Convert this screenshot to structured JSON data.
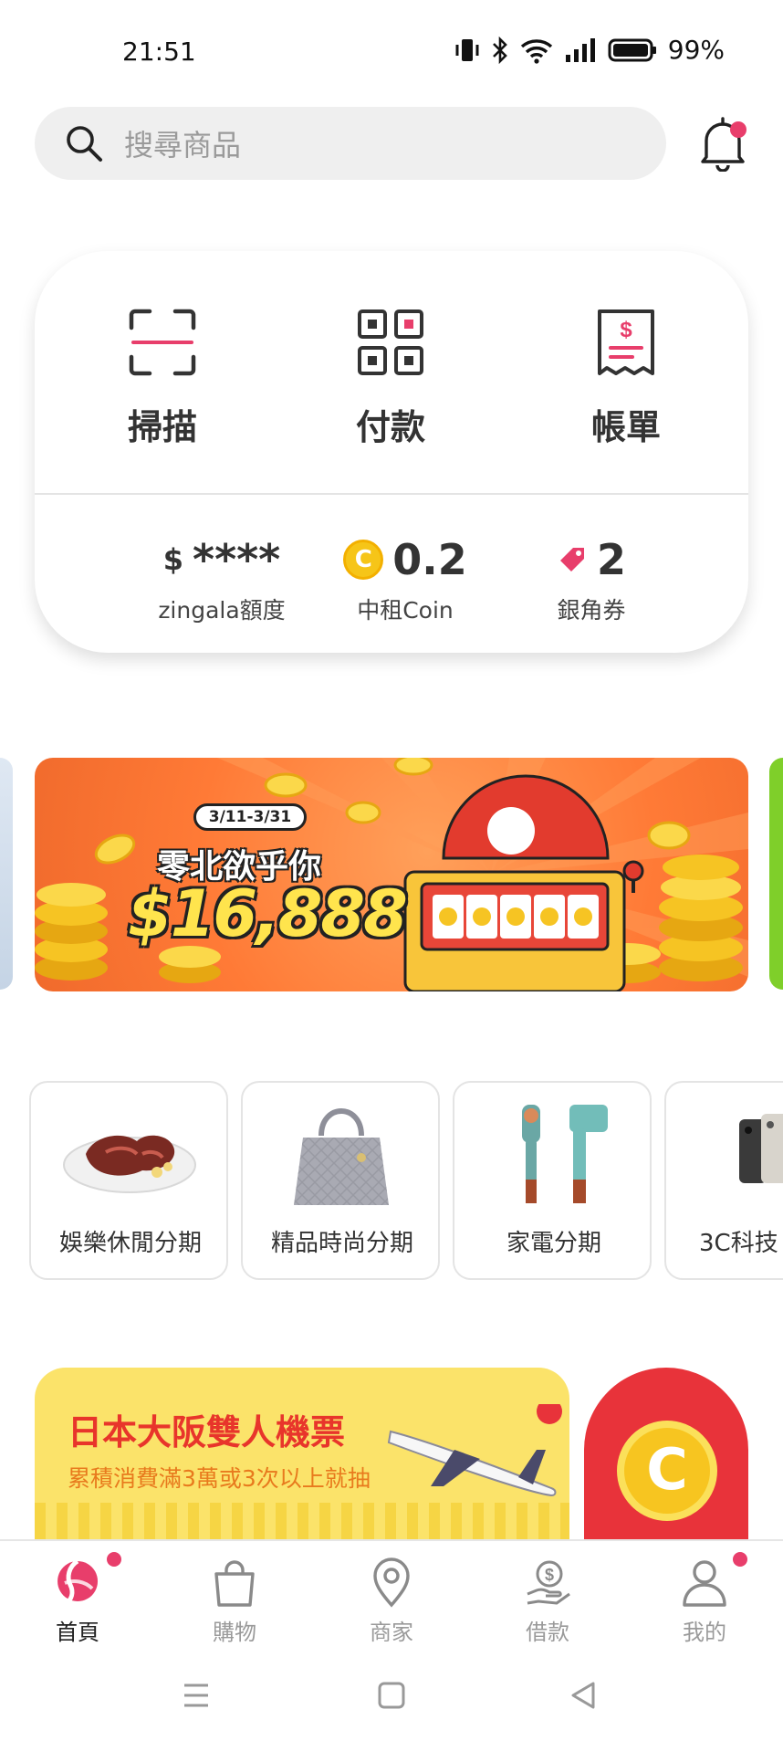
{
  "status_bar": {
    "time": "21:51",
    "battery": "99%"
  },
  "search": {
    "placeholder": "搜尋商品"
  },
  "actions": [
    {
      "label": "掃描",
      "icon": "scan-icon"
    },
    {
      "label": "付款",
      "icon": "qr-code-icon"
    },
    {
      "label": "帳單",
      "icon": "bill-icon"
    }
  ],
  "stats": {
    "credit": {
      "value": "****",
      "currency": "$",
      "label": "zingala額度"
    },
    "coin": {
      "value": "0.2",
      "label": "中租Coin",
      "symbol": "C"
    },
    "coupon": {
      "value": "2",
      "label": "銀角券"
    }
  },
  "banner": {
    "date": "3/11-3/31",
    "title": "零北欲乎你",
    "amount": "$16,888"
  },
  "categories": [
    {
      "label": "娛樂休閒分期",
      "icon": "steak-icon"
    },
    {
      "label": "精品時尚分期",
      "icon": "handbag-icon"
    },
    {
      "label": "家電分期",
      "icon": "hair-dryer-icon"
    },
    {
      "label": "3C科技",
      "icon": "phone-icon"
    }
  ],
  "promo": {
    "title": "日本大阪雙人機票",
    "subtitle": "累積消費滿3萬或3次以上就抽",
    "coin_symbol": "C"
  },
  "bottom_nav": [
    {
      "label": "首頁",
      "icon": "home-icon",
      "active": true
    },
    {
      "label": "購物",
      "icon": "shopping-bag-icon",
      "active": false
    },
    {
      "label": "商家",
      "icon": "location-pin-icon",
      "active": false
    },
    {
      "label": "借款",
      "icon": "loan-icon",
      "active": false
    },
    {
      "label": "我的",
      "icon": "profile-icon",
      "active": false
    }
  ],
  "colors": {
    "accent": "#e83e6b",
    "coin": "#f6c518",
    "banner": "#ff7a36",
    "promo": "#fbe36a"
  }
}
